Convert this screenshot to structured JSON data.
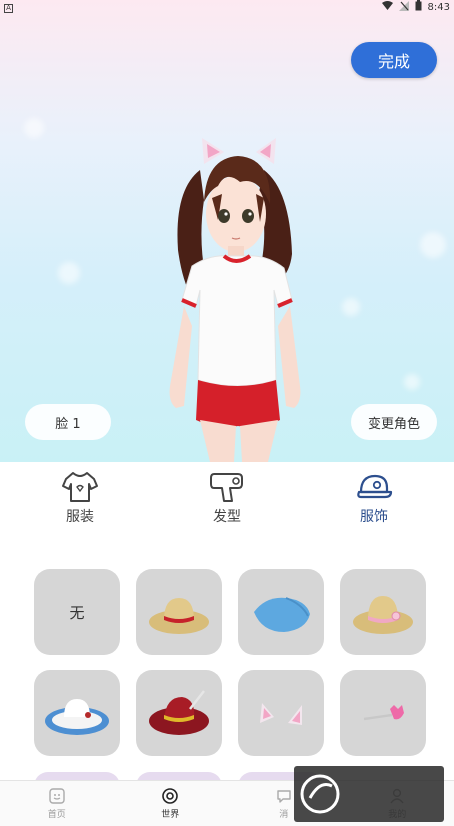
{
  "status_bar": {
    "time": "8:43"
  },
  "header": {
    "done_label": "完成"
  },
  "scene": {
    "face_label": "脸 1",
    "change_character_label": "变更角色"
  },
  "tabs": [
    {
      "label": "服装",
      "icon": "shirt-icon"
    },
    {
      "label": "发型",
      "icon": "hairdryer-icon"
    },
    {
      "label": "服饰",
      "icon": "cap-icon"
    }
  ],
  "items": [
    {
      "label": "无"
    },
    {
      "icon": "straw-hat-red-band-icon"
    },
    {
      "icon": "blue-beret-icon"
    },
    {
      "icon": "straw-hat-pink-flower-icon"
    },
    {
      "icon": "blue-white-sunhat-icon"
    },
    {
      "icon": "red-feather-hat-icon"
    },
    {
      "icon": "cat-ears-icon"
    },
    {
      "icon": "pink-hairpin-icon"
    }
  ],
  "bottom_nav": [
    {
      "label": "首页",
      "icon": "home-icon"
    },
    {
      "label": "世界",
      "icon": "world-icon"
    },
    {
      "label": "消",
      "icon": "message-icon"
    },
    {
      "label": "我的",
      "icon": "user-icon"
    }
  ],
  "colors": {
    "accent": "#2f6fd8",
    "active_tab": "#2d4f8e"
  }
}
